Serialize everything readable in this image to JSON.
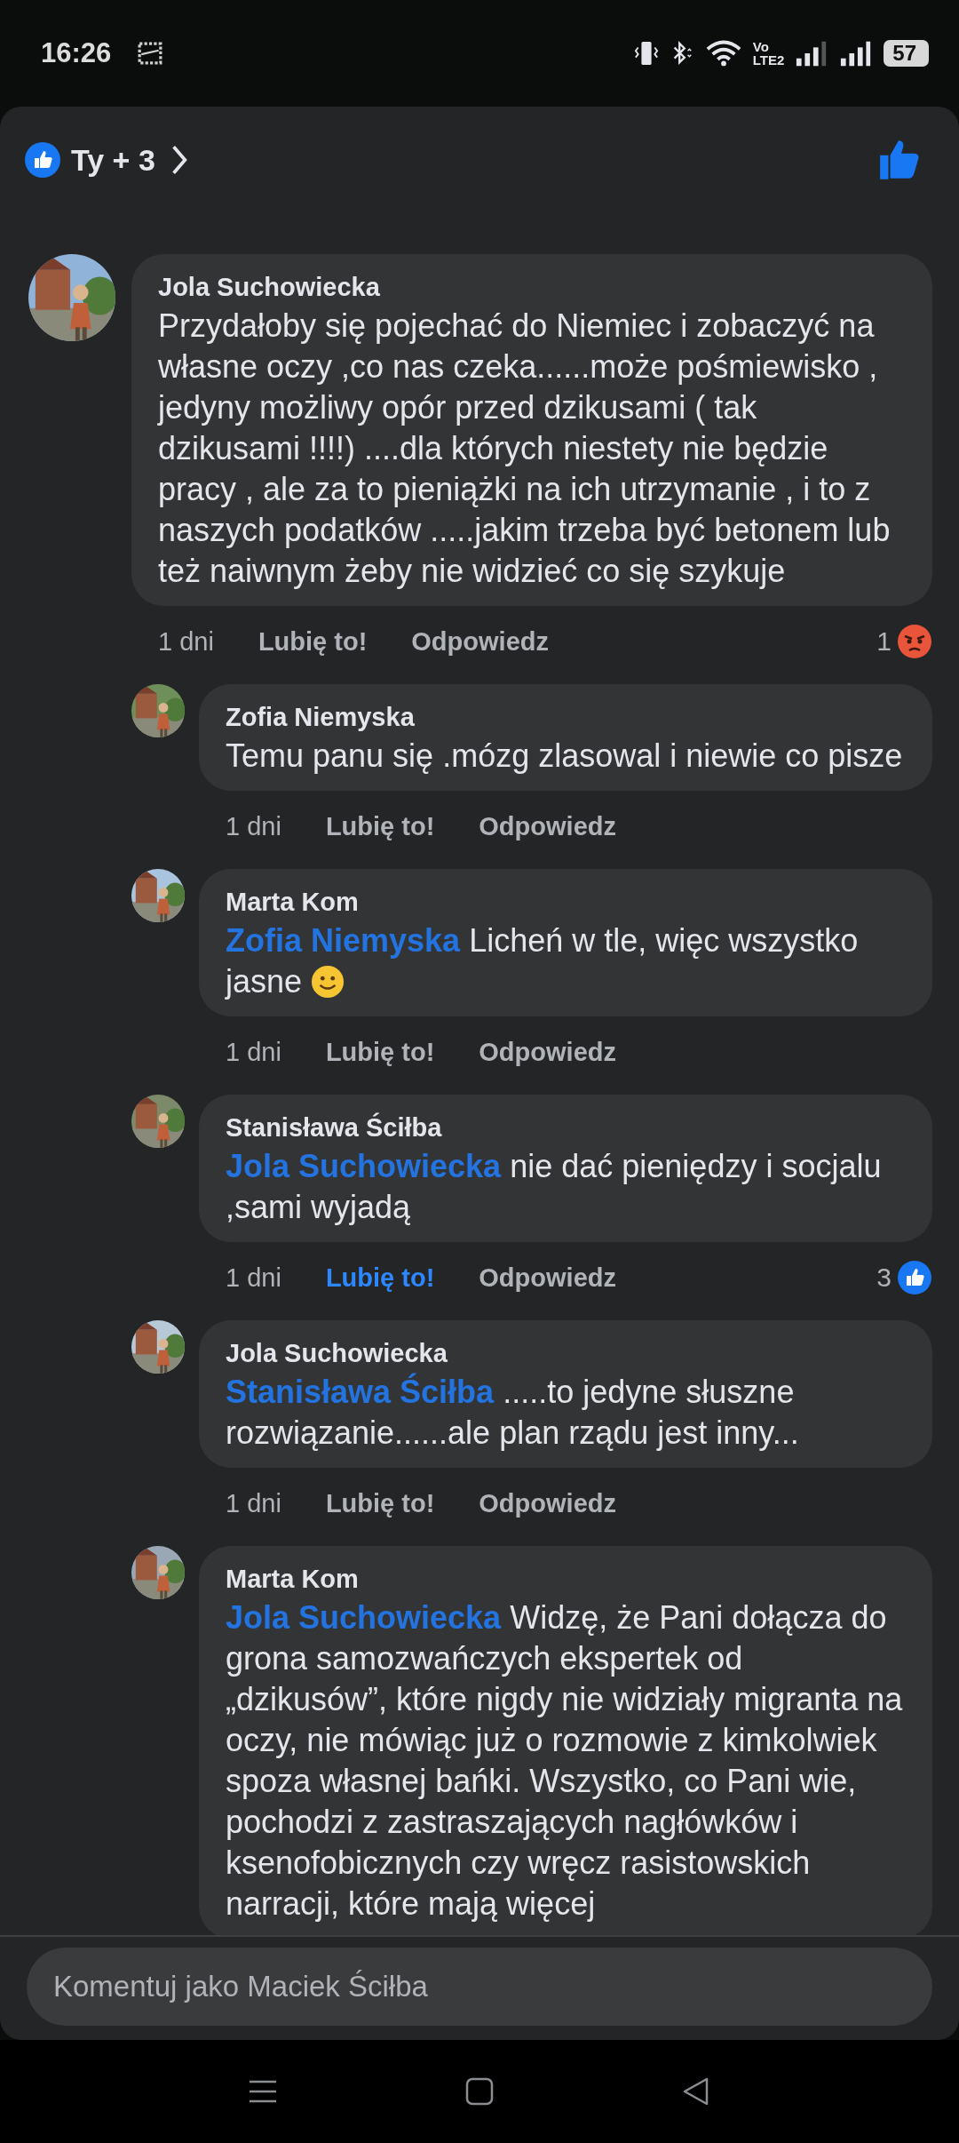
{
  "status_bar": {
    "time": "16:26",
    "volte_top": "Vo",
    "volte_bottom": "LTE2",
    "battery": "57"
  },
  "header": {
    "reactions_summary": "Ty + 3"
  },
  "comments": [
    {
      "author": "Jola Suchowiecka",
      "text": "Przydałoby się pojechać do Niemiec i zobaczyć na własne oczy ,co nas czeka......może pośmiewisko , jedyny możliwy opór przed dzikusami ( tak dzikusami !!!!) ....dla których niestety nie będzie pracy , ale za to pieniążki na ich utrzymanie , i to z naszych podatków .....jakim  trzeba być betonem lub też naiwnym żeby nie widzieć co się szykuje",
      "time": "1 dni",
      "like_label": "Lubię to!",
      "liked": false,
      "reply_label": "Odpowiedz",
      "reaction": {
        "count": "1",
        "kind": "angry"
      },
      "replies": [
        {
          "author": "Zofia Niemyska",
          "text": "Temu panu się .mózg zlasowal i niewie co pisze",
          "time": "1 dni",
          "like_label": "Lubię to!",
          "liked": false,
          "reply_label": "Odpowiedz"
        },
        {
          "author": "Marta Kom",
          "mention": "Zofia Niemyska",
          "text": "Licheń w tle, więc wszystko jasne",
          "smiley": true,
          "time": "1 dni",
          "like_label": "Lubię to!",
          "liked": false,
          "reply_label": "Odpowiedz"
        },
        {
          "author": "Stanisława Ściłba",
          "mention": "Jola Suchowiecka",
          "text": "nie dać pieniędzy i socjalu ,sami wyjadą",
          "time": "1 dni",
          "like_label": "Lubię to!",
          "liked": true,
          "reply_label": "Odpowiedz",
          "reaction": {
            "count": "3",
            "kind": "like"
          }
        },
        {
          "author": "Jola Suchowiecka",
          "mention": "Stanisława Ściłba",
          "text": ".....to jedyne słuszne rozwiązanie......ale plan  rządu jest inny...",
          "time": "1 dni",
          "like_label": "Lubię to!",
          "liked": false,
          "reply_label": "Odpowiedz"
        },
        {
          "author": "Marta Kom",
          "mention": "Jola Suchowiecka",
          "text": "Widzę, że Pani dołącza do grona samozwańczych ekspertek od „dzikusów”, które nigdy nie widziały migranta na oczy, nie mówiąc już o rozmowie z kimkolwiek spoza własnej bańki. Wszystko, co Pani wie, pochodzi z zastraszających nagłówków i ksenofobicznych czy wręcz rasistowskich narracji, które mają więcej"
        }
      ]
    }
  ],
  "composer": {
    "placeholder": "Komentuj jako Maciek Ściłba"
  }
}
